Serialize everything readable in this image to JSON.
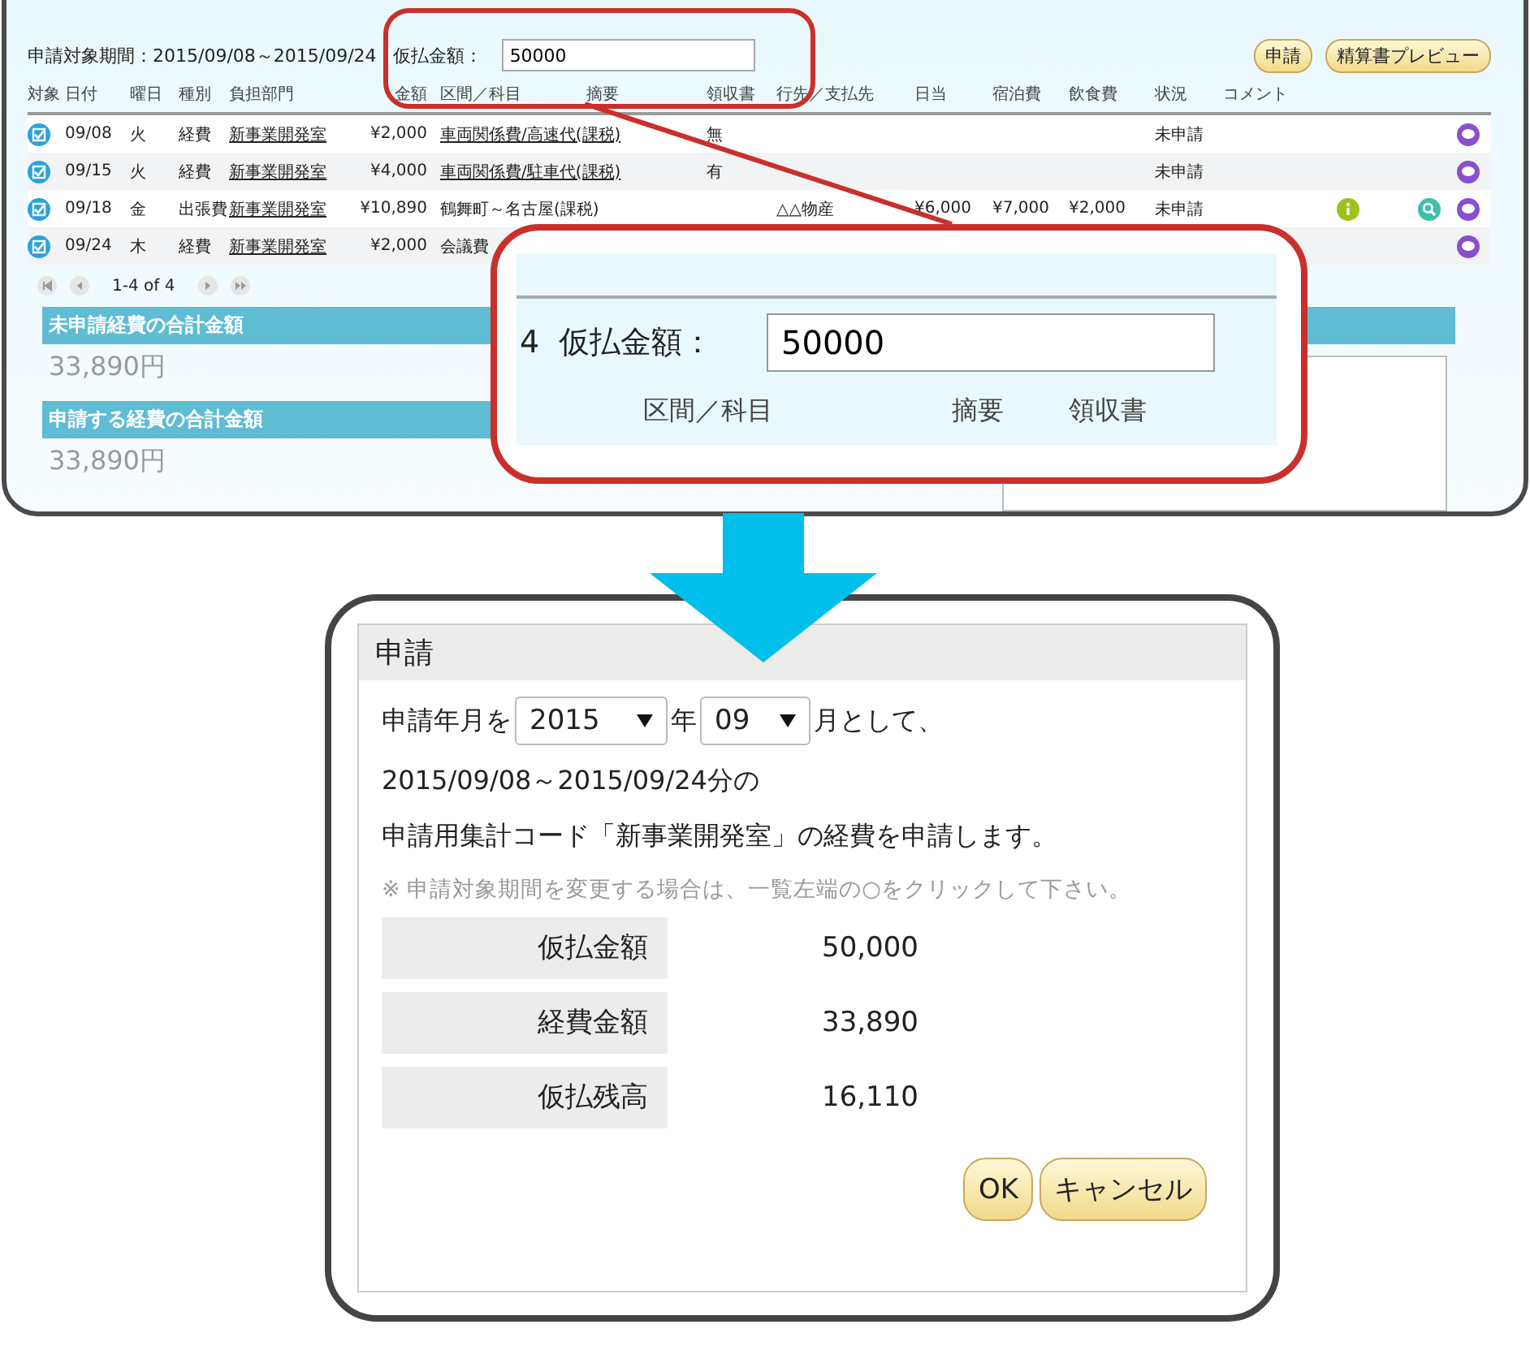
{
  "top_panel": {
    "period_label": "申請対象期間：2015/09/08～2015/09/24",
    "advance_label": "仮払金額：",
    "advance_value": "50000",
    "buttons": [
      "申請",
      "精算書プレビュー"
    ],
    "columns": [
      "対象",
      "日付",
      "曜日",
      "種別",
      "負担部門",
      "金額",
      "区間／科目",
      "摘要",
      "領収書",
      "行先／支払先",
      "日当",
      "宿泊費",
      "飲食費",
      "状況",
      "コメント"
    ],
    "rows": [
      {
        "checked": true,
        "date": "09/08",
        "weekday": "火",
        "type": "経費",
        "dept": "新事業開発室",
        "amount": "¥2,000",
        "route": {
          "text": "車両関係費/高速代(課税)",
          "link": true
        },
        "receipt": "無",
        "status": "未申請",
        "info_icon": false,
        "search_icon": false
      },
      {
        "checked": true,
        "date": "09/15",
        "weekday": "火",
        "type": "経費",
        "dept": "新事業開発室",
        "amount": "¥4,000",
        "route": {
          "text": "車両関係費/駐車代(課税)",
          "link": true
        },
        "receipt": "有",
        "status": "未申請",
        "info_icon": false,
        "search_icon": false
      },
      {
        "checked": true,
        "date": "09/18",
        "weekday": "金",
        "type": "出張費",
        "dept": "新事業開発室",
        "amount": "¥10,890",
        "route": {
          "text": "鶴舞町～名古屋(課税)",
          "link": false
        },
        "destination": "△△物産",
        "daily": "¥6,000",
        "lodging": "¥7,000",
        "meals": "¥2,000",
        "status": "未申請",
        "info_icon": true,
        "search_icon": true
      },
      {
        "checked": true,
        "date": "09/24",
        "weekday": "木",
        "type": "経費",
        "dept": "新事業開発室",
        "amount": "¥2,000",
        "route": {
          "text": "会議費",
          "link": false
        },
        "info_icon": false,
        "search_icon": false
      }
    ],
    "pager": "1-4 of 4",
    "totals": [
      {
        "label": "未申請経費の合計金額",
        "value": "33,890円"
      },
      {
        "label": "申請する経費の合計金額",
        "value": "33,890円"
      }
    ]
  },
  "zoom_callout": {
    "count_fragment": "4",
    "label": "仮払金額：",
    "value": "50000",
    "columns": [
      "区間／科目",
      "摘要",
      "領収書"
    ]
  },
  "dialog": {
    "title": "申請",
    "line1_before": "申請年月を",
    "year": "2015",
    "year_suffix": "年",
    "month": "09",
    "line1_after": "月として、",
    "line2": "2015/09/08～2015/09/24分の",
    "line3": "申請用集計コード「新事業開発室」の経費を申請します。",
    "note": "※ 申請対象期間を変更する場合は、一覧左端の○をクリックして下さい。",
    "summary": [
      {
        "label": "仮払金額",
        "value": "50,000"
      },
      {
        "label": "経費金額",
        "value": "33,890"
      },
      {
        "label": "仮払残高",
        "value": "16,110"
      }
    ],
    "buttons": [
      "OK",
      "キャンセル"
    ]
  }
}
